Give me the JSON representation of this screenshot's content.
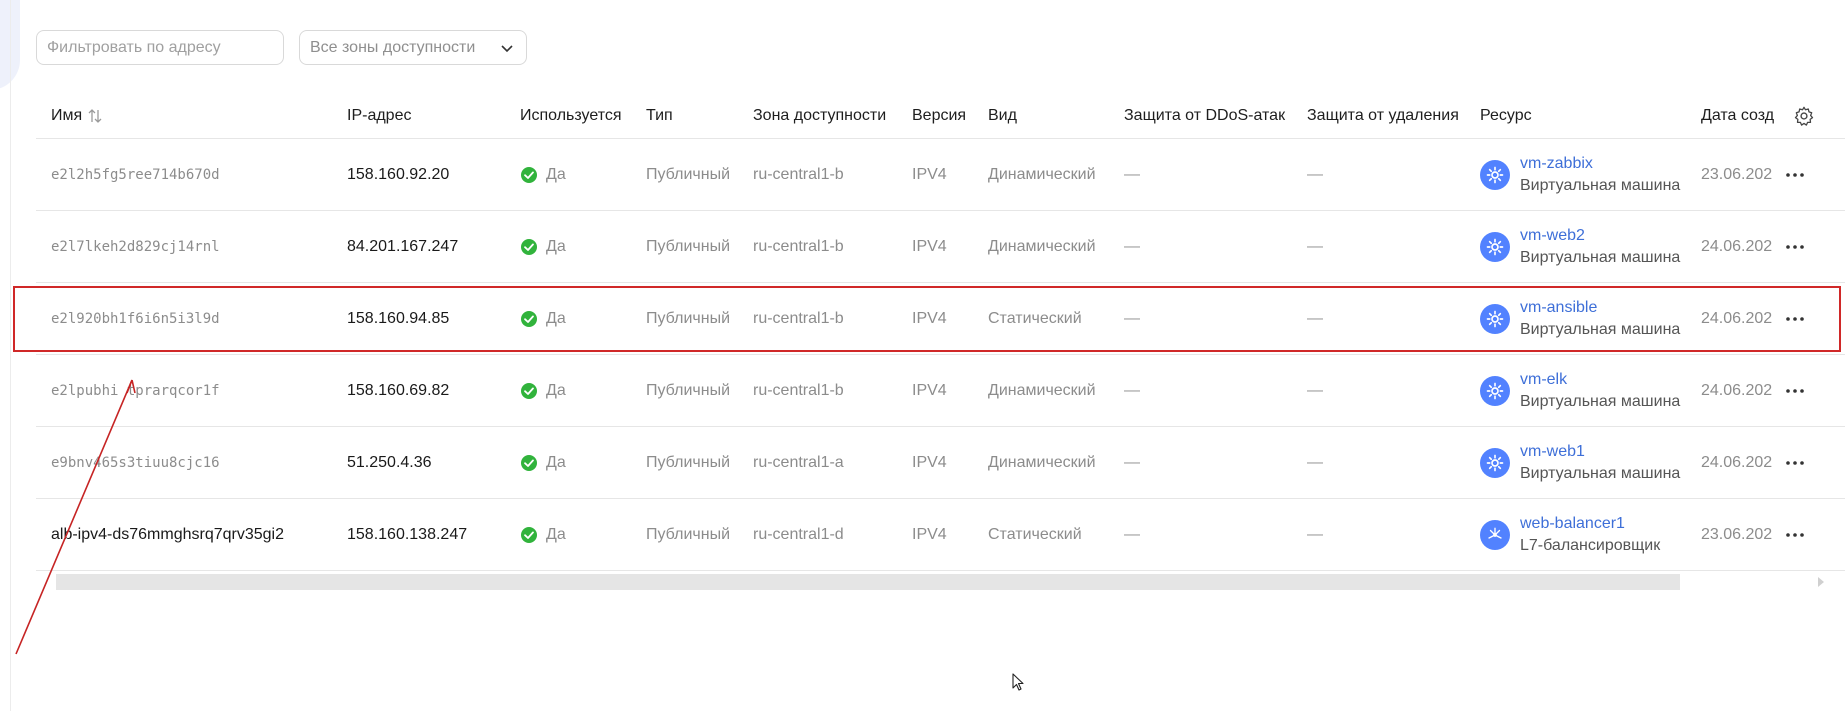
{
  "filters": {
    "address_placeholder": "Фильтровать по адресу",
    "zone_select_value": "Все зоны доступности"
  },
  "table": {
    "columns": {
      "name": "Имя",
      "ip": "IP-адрес",
      "used": "Используется",
      "type": "Тип",
      "zone": "Зона доступности",
      "version": "Версия",
      "kind": "Вид",
      "ddos": "Защита от DDoS-атак",
      "deletion": "Защита от удаления",
      "resource": "Ресурс",
      "date": "Дата созд"
    },
    "rows": [
      {
        "name": "e2l2h5fg5ree714b670d",
        "ip": "158.160.92.20",
        "used": "Да",
        "type": "Публичный",
        "zone": "ru-central1-b",
        "version": "IPV4",
        "kind": "Динамический",
        "ddos": "—",
        "deletion": "—",
        "resource_name": "vm-zabbix",
        "resource_type": "Виртуальная машина",
        "date": "23.06.202"
      },
      {
        "name": "e2l7lkeh2d829cj14rnl",
        "ip": "84.201.167.247",
        "used": "Да",
        "type": "Публичный",
        "zone": "ru-central1-b",
        "version": "IPV4",
        "kind": "Динамический",
        "ddos": "—",
        "deletion": "—",
        "resource_name": "vm-web2",
        "resource_type": "Виртуальная машина",
        "date": "24.06.202"
      },
      {
        "name": "e2l920bh1f6i6n5i3l9d",
        "ip": "158.160.94.85",
        "used": "Да",
        "type": "Публичный",
        "zone": "ru-central1-b",
        "version": "IPV4",
        "kind": "Статический",
        "ddos": "—",
        "deletion": "—",
        "resource_name": "vm-ansible",
        "resource_type": "Виртуальная машина",
        "date": "24.06.202"
      },
      {
        "name": "e2lpubhi tprarqcor1f",
        "ip": "158.160.69.82",
        "used": "Да",
        "type": "Публичный",
        "zone": "ru-central1-b",
        "version": "IPV4",
        "kind": "Динамический",
        "ddos": "—",
        "deletion": "—",
        "resource_name": "vm-elk",
        "resource_type": "Виртуальная машина",
        "date": "24.06.202"
      },
      {
        "name": "e9bnv465s3tiuu8cjc16",
        "ip": "51.250.4.36",
        "used": "Да",
        "type": "Публичный",
        "zone": "ru-central1-a",
        "version": "IPV4",
        "kind": "Динамический",
        "ddos": "—",
        "deletion": "—",
        "resource_name": "vm-web1",
        "resource_type": "Виртуальная машина",
        "date": "24.06.202"
      },
      {
        "name": "alb-ipv4-ds76mmghsrq7qrv35gi2",
        "ip": "158.160.138.247",
        "used": "Да",
        "type": "Публичный",
        "zone": "ru-central1-d",
        "version": "IPV4",
        "kind": "Статический",
        "ddos": "—",
        "deletion": "—",
        "resource_name": "web-balancer1",
        "resource_type": "L7-балансировщик",
        "date": "23.06.202"
      }
    ]
  },
  "colors": {
    "link": "#3e6fd8",
    "resource_icon": "#5282ff",
    "check": "#31b33c",
    "highlight": "#d02828"
  },
  "icons": {
    "sort": "sort-arrows-icon",
    "chevron": "chevron-down-icon",
    "check": "check-circle-icon",
    "vm": "gear-icon",
    "balancer": "balancer-icon",
    "menu": "more-dots-icon",
    "settings": "settings-gear-icon"
  }
}
